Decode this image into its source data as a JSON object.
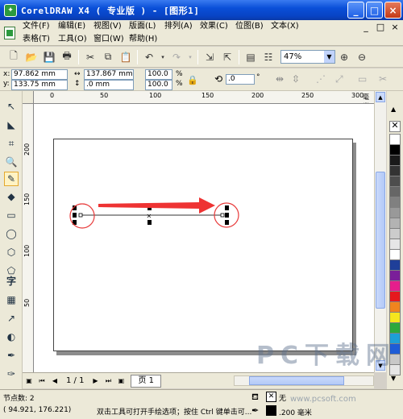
{
  "window": {
    "title": "CorelDRAW X4 ( 专业版 ) - [图形1]",
    "minimize": "_",
    "maximize": "□",
    "close": "×"
  },
  "menu": {
    "row1": [
      "文件(F)",
      "编辑(E)",
      "视图(V)",
      "版面(L)",
      "排列(A)",
      "效果(C)",
      "位图(B)",
      "文本(X)"
    ],
    "row2": [
      "表格(T)",
      "工具(O)",
      "窗口(W)",
      "帮助(H)"
    ],
    "doc_controls": [
      "_",
      "□",
      "×"
    ]
  },
  "toolbar": {
    "zoom_value": "47%",
    "icons": [
      "new-icon",
      "open-icon",
      "save-icon",
      "print-icon",
      "cut-icon",
      "copy-icon",
      "paste-icon",
      "undo-icon",
      "redo-icon",
      "import-icon",
      "export-icon",
      "app-launcher-icon",
      "welcome-icon"
    ]
  },
  "property_bar": {
    "x_label": "x:",
    "x_value": "97.862 mm",
    "y_label": "y:",
    "y_value": "133.75 mm",
    "w_value": "137.867 mm",
    "h_value": ".0 mm",
    "scale_x": "100.0",
    "scale_y": "100.0",
    "percent": "%",
    "rotation": ".0",
    "degree": "°"
  },
  "rulers": {
    "top_labels": [
      "0",
      "50",
      "100",
      "150",
      "200",
      "250",
      "300"
    ],
    "top_unit": "毫米",
    "left_labels": [
      "200",
      "150",
      "100",
      "50"
    ]
  },
  "navigator": {
    "page_count": "1 / 1",
    "page_tab": "页 1"
  },
  "status": {
    "node_count": "节点数: 2",
    "coords": "( 94.921, 176.221)",
    "hint": "双击工具可打开手绘选项；按住 Ctrl 键单击可...",
    "fill_label": "无",
    "outline_width": ".200 毫米"
  },
  "watermark": {
    "text": "PC下载网",
    "url": "www.pcsoft.com"
  },
  "palette": [
    "#ffffff",
    "#000000",
    "#1a1a1a",
    "#333333",
    "#4d4d4d",
    "#666666",
    "#808080",
    "#999999",
    "#b3b3b3",
    "#cccccc",
    "#e6e6e6",
    "#ffffff",
    "#1f3f99",
    "#7a1f99",
    "#e61e8c",
    "#e6191e",
    "#f0841e",
    "#f5e61e",
    "#2ca83c",
    "#1e9fd6",
    "#1e5cd6",
    "#c8c8c8",
    "#e6e6e6"
  ],
  "colors": {
    "arrow": "#ee3333",
    "circle": "#e83a3a",
    "title_bg": "#0a4fd8"
  }
}
